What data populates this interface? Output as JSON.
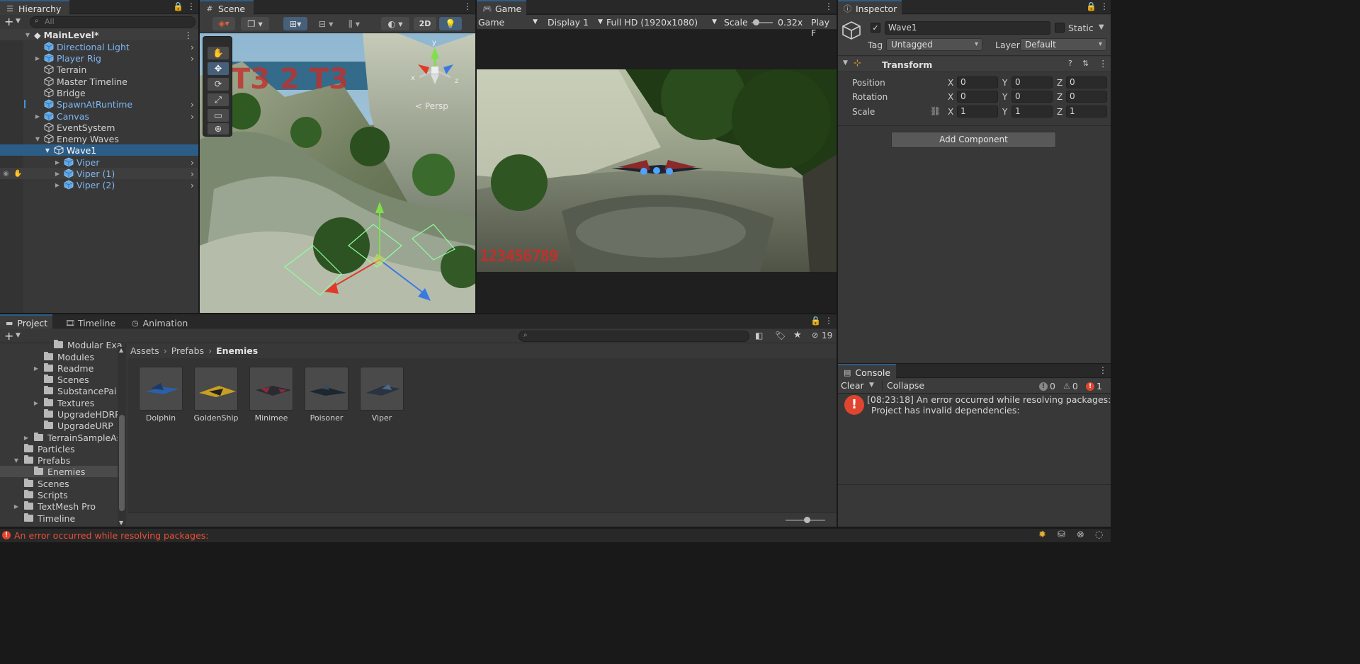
{
  "hierarchy": {
    "tab": "Hierarchy",
    "search_placeholder": "All",
    "scene": "MainLevel*",
    "items": [
      {
        "label": "Directional Light"
      },
      {
        "label": "Player Rig"
      },
      {
        "label": "Terrain"
      },
      {
        "label": "Master Timeline"
      },
      {
        "label": "Bridge"
      },
      {
        "label": "SpawnAtRuntime"
      },
      {
        "label": "Canvas"
      },
      {
        "label": "EventSystem"
      },
      {
        "label": "Enemy Waves"
      },
      {
        "label": "Wave1"
      },
      {
        "label": "Viper"
      },
      {
        "label": "Viper (1)"
      },
      {
        "label": "Viper (2)"
      }
    ]
  },
  "scene_view": {
    "tab": "Scene",
    "toggle_2d": "2D",
    "gizmo_x": "x",
    "gizmo_y": "y",
    "gizmo_z": "z",
    "persp": "< Persp"
  },
  "game_view": {
    "tab": "Game",
    "mode": "Game",
    "display": "Display 1",
    "resolution": "Full HD (1920x1080)",
    "scale_label": "Scale",
    "scale_value": "0.32x",
    "play_focus": "Play F",
    "score_text": "123456789"
  },
  "inspector": {
    "tab": "Inspector",
    "object_name": "Wave1",
    "static_label": "Static",
    "tag_label": "Tag",
    "tag_value": "Untagged",
    "layer_label": "Layer",
    "layer_value": "Default",
    "transform_title": "Transform",
    "position_label": "Position",
    "rotation_label": "Rotation",
    "scale_label": "Scale",
    "axis_x": "X",
    "axis_y": "Y",
    "axis_z": "Z",
    "position": {
      "x": "0",
      "y": "0",
      "z": "0"
    },
    "rotation": {
      "x": "0",
      "y": "0",
      "z": "0"
    },
    "scale": {
      "x": "1",
      "y": "1",
      "z": "1"
    },
    "add_component": "Add Component"
  },
  "project": {
    "tabs": [
      "Project",
      "Timeline",
      "Animation"
    ],
    "hidden_count": "19",
    "breadcrumb": [
      "Assets",
      "Prefabs",
      "Enemies"
    ],
    "tree": [
      {
        "label": "Modular Exa"
      },
      {
        "label": "Modules"
      },
      {
        "label": "Readme"
      },
      {
        "label": "Scenes"
      },
      {
        "label": "SubstancePai"
      },
      {
        "label": "Textures"
      },
      {
        "label": "UpgradeHDRP"
      },
      {
        "label": "UpgradeURP"
      },
      {
        "label": "TerrainSampleAs"
      },
      {
        "label": "Particles"
      },
      {
        "label": "Prefabs"
      },
      {
        "label": "Enemies"
      },
      {
        "label": "Scenes"
      },
      {
        "label": "Scripts"
      },
      {
        "label": "TextMesh Pro"
      },
      {
        "label": "Timeline"
      }
    ],
    "assets": [
      {
        "name": "Dolphin",
        "color": "#2b5fa8"
      },
      {
        "name": "GoldenShip",
        "color": "#c8a020"
      },
      {
        "name": "Minimee",
        "color": "#8a2a3a"
      },
      {
        "name": "Poisoner",
        "color": "#3a4a5a"
      },
      {
        "name": "Viper",
        "color": "#4a6a8a"
      }
    ]
  },
  "console": {
    "tab": "Console",
    "clear": "Clear",
    "collapse": "Collapse",
    "info_count": "0",
    "warn_count": "0",
    "error_count": "1",
    "message_line1": "[08:23:18] An error occurred while resolving packages:",
    "message_line2": "Project has invalid dependencies:"
  },
  "status_bar": {
    "message": "An error occurred while resolving packages:"
  },
  "colors": {
    "selection": "#2c5d87",
    "accent_blue": "#7fb7f3",
    "error_red": "#e0452f",
    "status_error_text": "#e8503a"
  }
}
